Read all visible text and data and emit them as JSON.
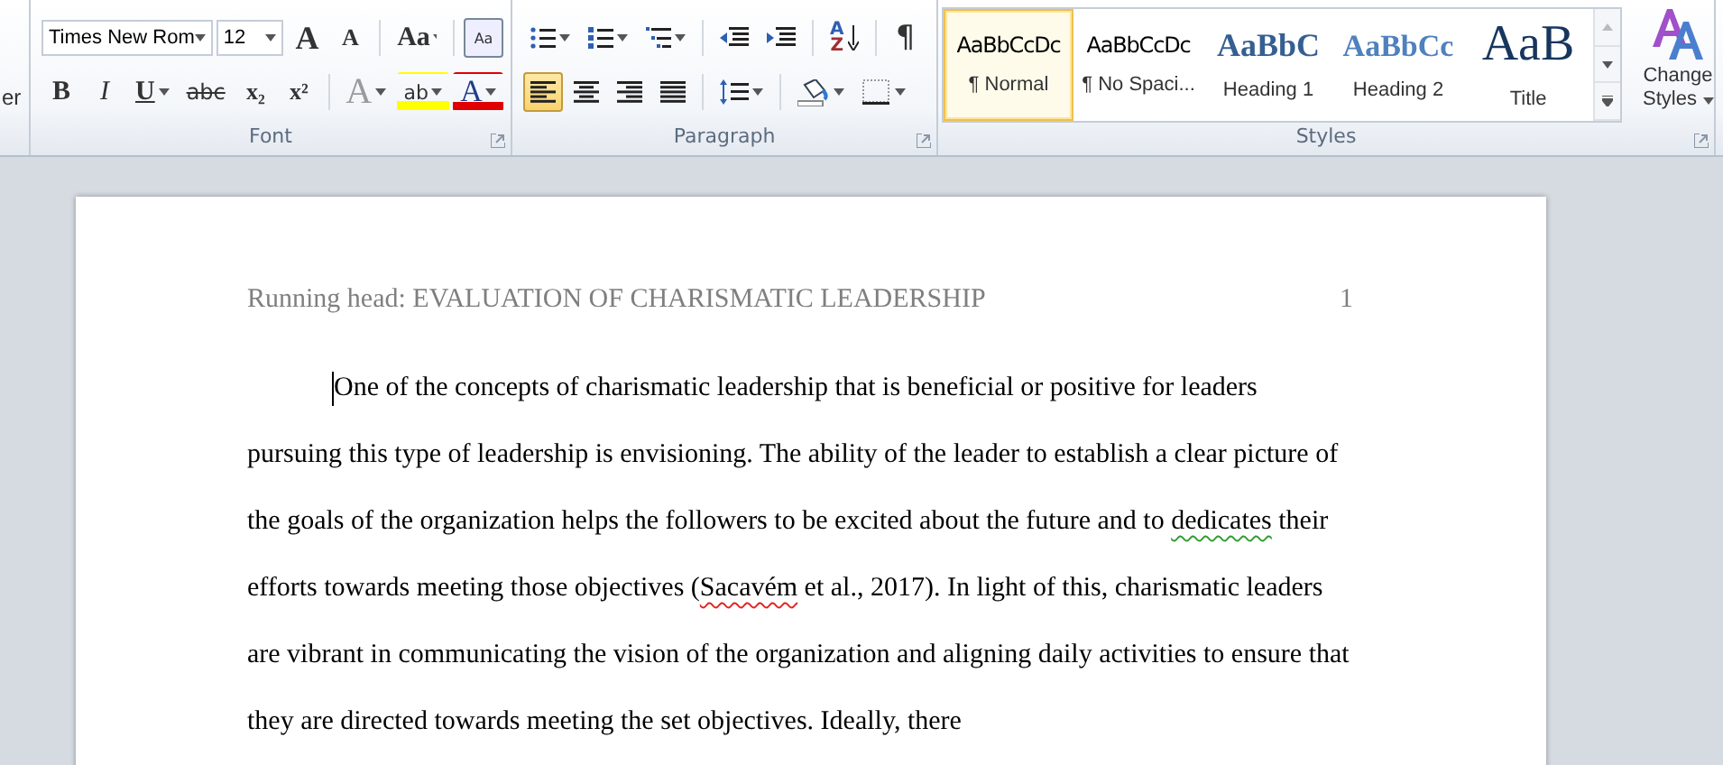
{
  "ribbon": {
    "cut_label": "er",
    "font": {
      "label": "Font",
      "font_name": "Times New Rom",
      "font_size": "12",
      "row1": [
        {
          "kind": "grow",
          "label": "A"
        },
        {
          "kind": "shrink",
          "label": "A"
        },
        {
          "kind": "case",
          "label": "Aa"
        },
        {
          "kind": "clear",
          "label": "Aa"
        }
      ],
      "row2": [
        {
          "kind": "bold",
          "label": "B",
          "disabled": false
        },
        {
          "kind": "italic",
          "label": "I",
          "disabled": false
        },
        {
          "kind": "underline",
          "label": "U",
          "disabled": false
        },
        {
          "kind": "strike",
          "label": "abc",
          "disabled": false
        },
        {
          "kind": "sub",
          "label": "x₂",
          "disabled": false
        },
        {
          "kind": "sup",
          "label": "x²",
          "disabled": false
        },
        {
          "kind": "effects",
          "label": "A",
          "disabled": true
        },
        {
          "kind": "highlight",
          "label": "ab",
          "disabled": false
        },
        {
          "kind": "color",
          "label": "A",
          "disabled": false
        }
      ]
    },
    "paragraph": {
      "label": "Paragraph",
      "sort": {
        "top": "A",
        "bottom": "Z"
      },
      "pilcrow": "¶",
      "align": [
        {
          "kind": "left",
          "selected": true
        },
        {
          "kind": "center",
          "selected": false
        },
        {
          "kind": "right",
          "selected": false
        },
        {
          "kind": "justify",
          "selected": false
        }
      ]
    },
    "styles": {
      "label": "Styles",
      "items": [
        {
          "preview": "AaBbCcDc",
          "name": "¶ Normal",
          "kind": "normal",
          "selected": true
        },
        {
          "preview": "AaBbCcDc",
          "name": "¶ No Spaci...",
          "kind": "normal",
          "selected": false
        },
        {
          "preview": "AaBbC",
          "name": "Heading 1",
          "kind": "heading1",
          "selected": false
        },
        {
          "preview": "AaBbCc",
          "name": "Heading 2",
          "kind": "heading2",
          "selected": false
        },
        {
          "preview": "AaB",
          "name": "Title",
          "kind": "title",
          "selected": false
        }
      ],
      "change_styles": {
        "label": "Change Styles"
      }
    }
  },
  "document": {
    "running_head": "Running head: EVALUATION OF CHARISMATIC LEADERSHIP",
    "page_number": "1",
    "paragraph": [
      {
        "kind": "plain",
        "text": "One of the concepts of charismatic leadership that is beneficial or positive for leaders pursuing this type of leadership is envisioning. The ability of the leader to establish a clear picture of the goals of the organization helps the followers to be excited about the future and to "
      },
      {
        "kind": "grammar",
        "text": "dedicates"
      },
      {
        "kind": "plain",
        "text": " their efforts towards meeting those objectives ("
      },
      {
        "kind": "spelling",
        "text": "Sacavém"
      },
      {
        "kind": "plain",
        "text": " et al., 2017). In light of this, charismatic leaders are vibrant in communicating the vision of the organization and aligning daily activities to ensure that they are directed towards meeting the set objectives. Ideally, there"
      }
    ]
  }
}
